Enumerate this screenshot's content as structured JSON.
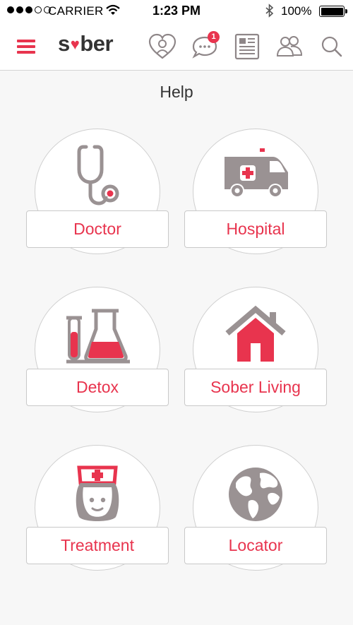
{
  "status_bar": {
    "carrier": "CARRIER",
    "time": "1:23 PM",
    "battery": "100%"
  },
  "nav": {
    "logo_left": "s",
    "logo_right": "ber",
    "messages_badge": "1",
    "icons": [
      "menu-icon",
      "heart-person-icon",
      "chat-icon",
      "newspaper-icon",
      "people-icon",
      "search-icon"
    ]
  },
  "page": {
    "title": "Help"
  },
  "tiles": [
    {
      "label": "Doctor",
      "icon": "stethoscope-icon"
    },
    {
      "label": "Hospital",
      "icon": "ambulance-icon"
    },
    {
      "label": "Detox",
      "icon": "lab-flasks-icon"
    },
    {
      "label": "Sober Living",
      "icon": "house-icon"
    },
    {
      "label": "Treatment",
      "icon": "nurse-icon"
    },
    {
      "label": "Locator",
      "icon": "globe-icon"
    }
  ],
  "colors": {
    "accent": "#e8344e",
    "icon_gray": "#9a9293",
    "background": "#f7f7f7"
  }
}
